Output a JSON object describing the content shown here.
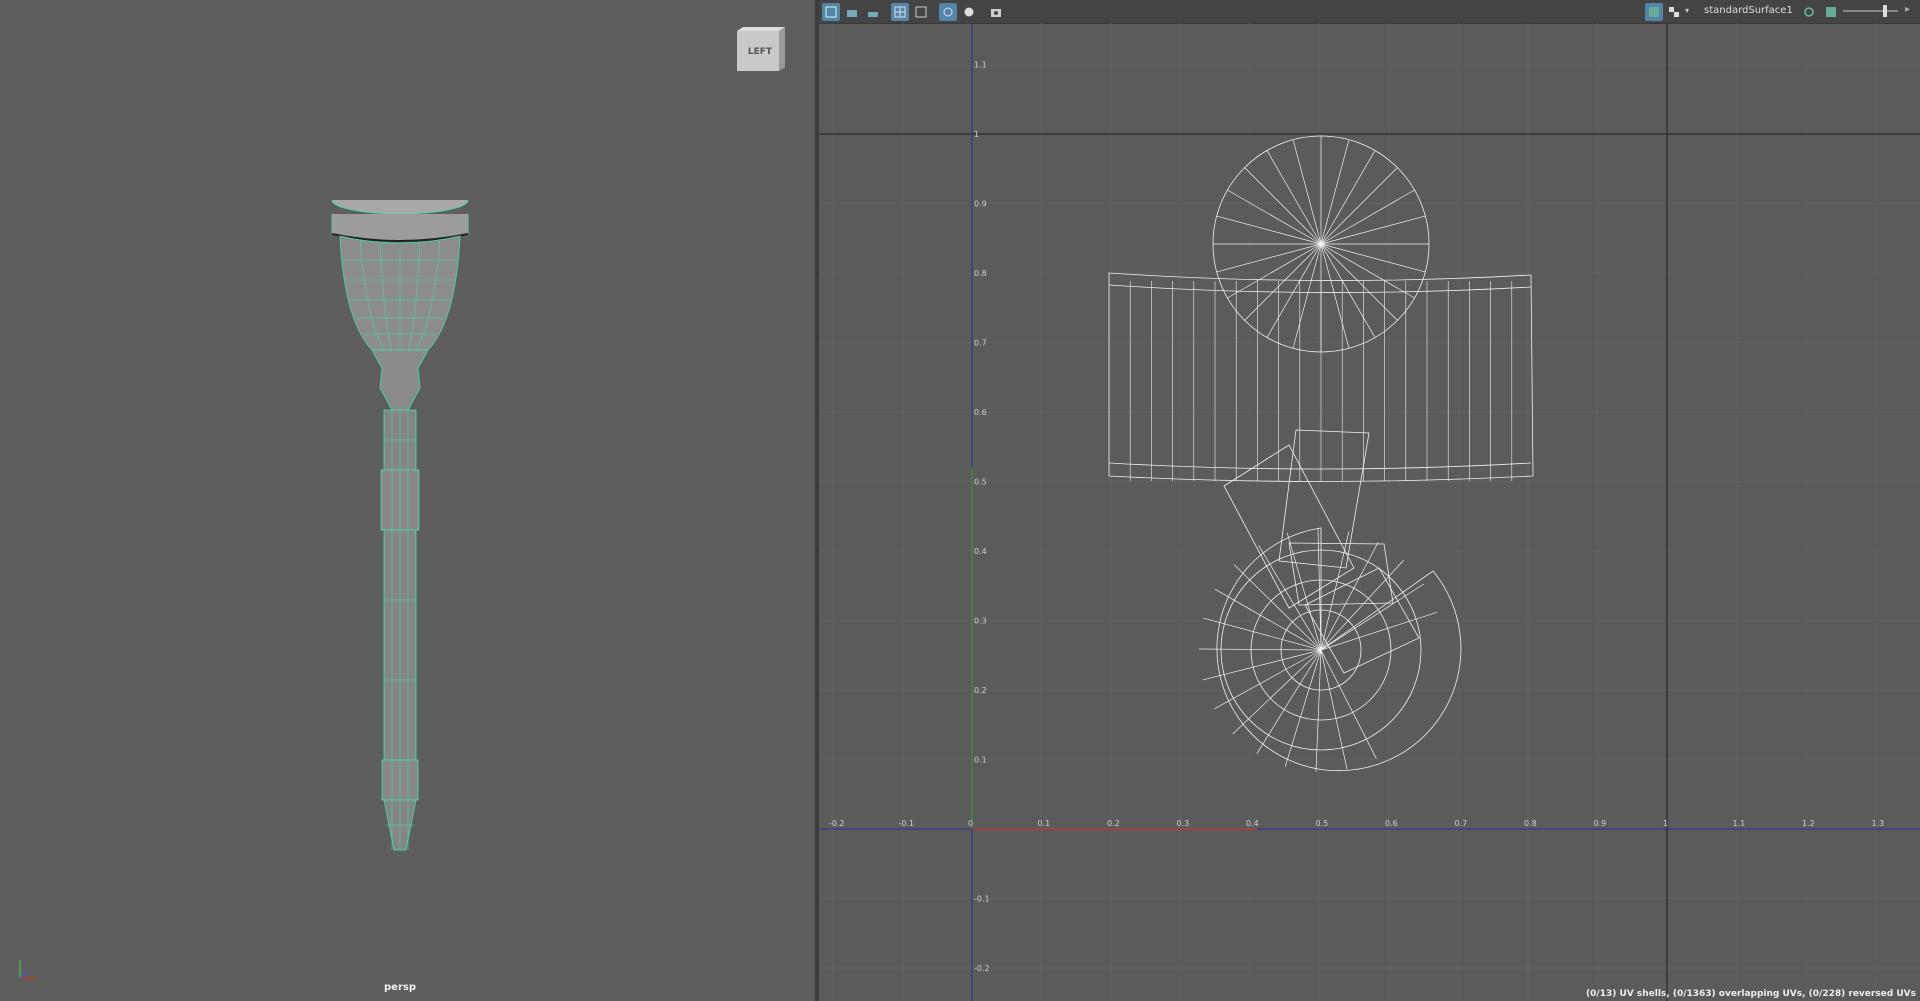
{
  "left_viewport": {
    "camera": "persp",
    "view_cube_face": "LEFT"
  },
  "uv_editor": {
    "toolbar_icons": [
      "uv-select-icon",
      "uv-move-icon",
      "uv-scale-icon",
      "grid-icon",
      "frame-icon",
      "snap-icon",
      "sphere-icon",
      "screenshot-icon"
    ],
    "shader": "standardSurface1",
    "status": "(0/13) UV shells, (0/1363) overlapping UVs, (0/228) reversed UVs",
    "x_ticks": [
      "-0.2",
      "-0.1",
      "0",
      "0.1",
      "0.2",
      "0.3",
      "0.4",
      "0.5",
      "0.6",
      "0.7",
      "0.8",
      "0.9",
      "1",
      "1.1",
      "1.2",
      "1.3"
    ],
    "y_ticks": [
      "1.1",
      "1",
      "0.9",
      "0.8",
      "0.7",
      "0.6",
      "0.5",
      "0.4",
      "0.3",
      "0.2",
      "0.1",
      "-0.1",
      "-0.2"
    ]
  },
  "colors": {
    "wire": "#3fe0b0",
    "uv_wire": "#f2f2f2",
    "axis_u": "#c0392b",
    "axis_v": "#2a2f9a"
  }
}
